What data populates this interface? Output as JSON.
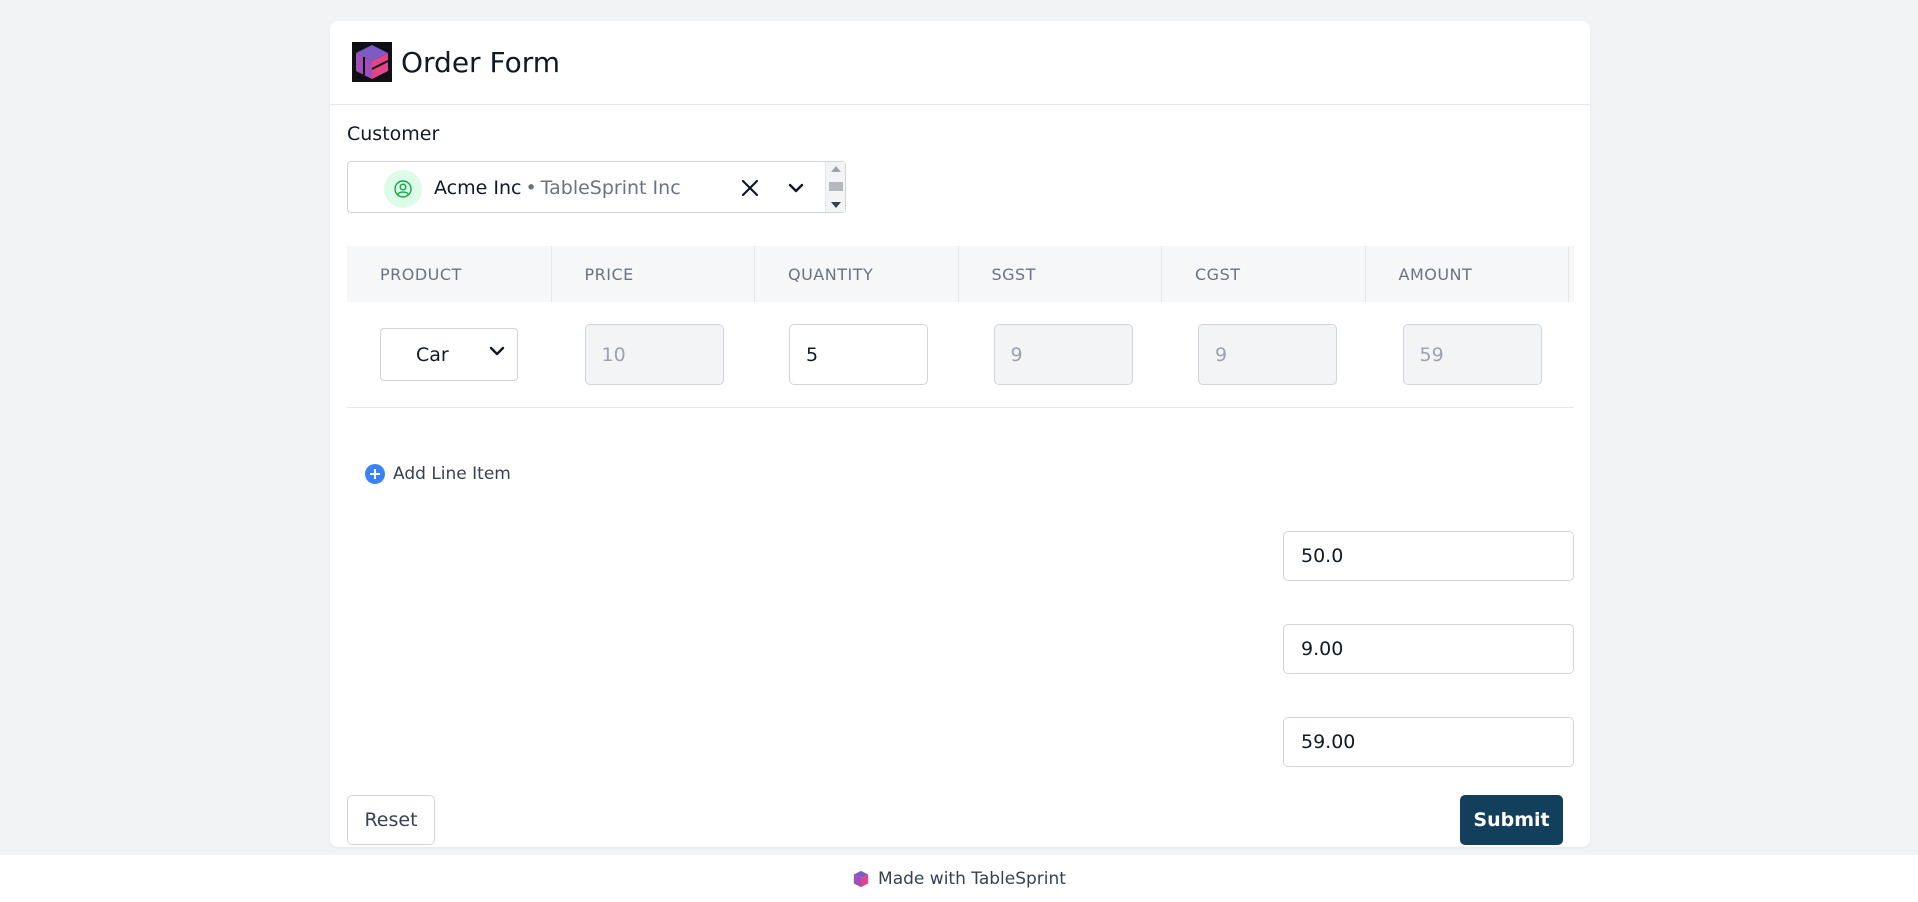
{
  "header": {
    "title": "Order Form",
    "logo_icon": "tablesprint-cube-logo"
  },
  "customer": {
    "label": "Customer",
    "selected_name": "Acme Inc",
    "separator": "•",
    "selected_org": "TableSprint Inc"
  },
  "table": {
    "columns": [
      "PRODUCT",
      "PRICE",
      "QUANTITY",
      "SGST",
      "CGST",
      "AMOUNT"
    ],
    "rows": [
      {
        "product": "Car",
        "price": "10",
        "quantity": "5",
        "sgst": "9",
        "cgst": "9",
        "amount": "59"
      }
    ]
  },
  "add_line_item": {
    "label": "Add Line Item"
  },
  "totals": {
    "subtotal": "50.0",
    "tax": "9.00",
    "total": "59.00"
  },
  "actions": {
    "reset": "Reset",
    "submit": "Submit"
  },
  "footer": {
    "text": "Made with TableSprint"
  },
  "colors": {
    "accent": "#123f5c",
    "add_icon": "#3b82f6",
    "avatar_bg": "#dcfce7",
    "page_bg": "#f2f3f5"
  }
}
